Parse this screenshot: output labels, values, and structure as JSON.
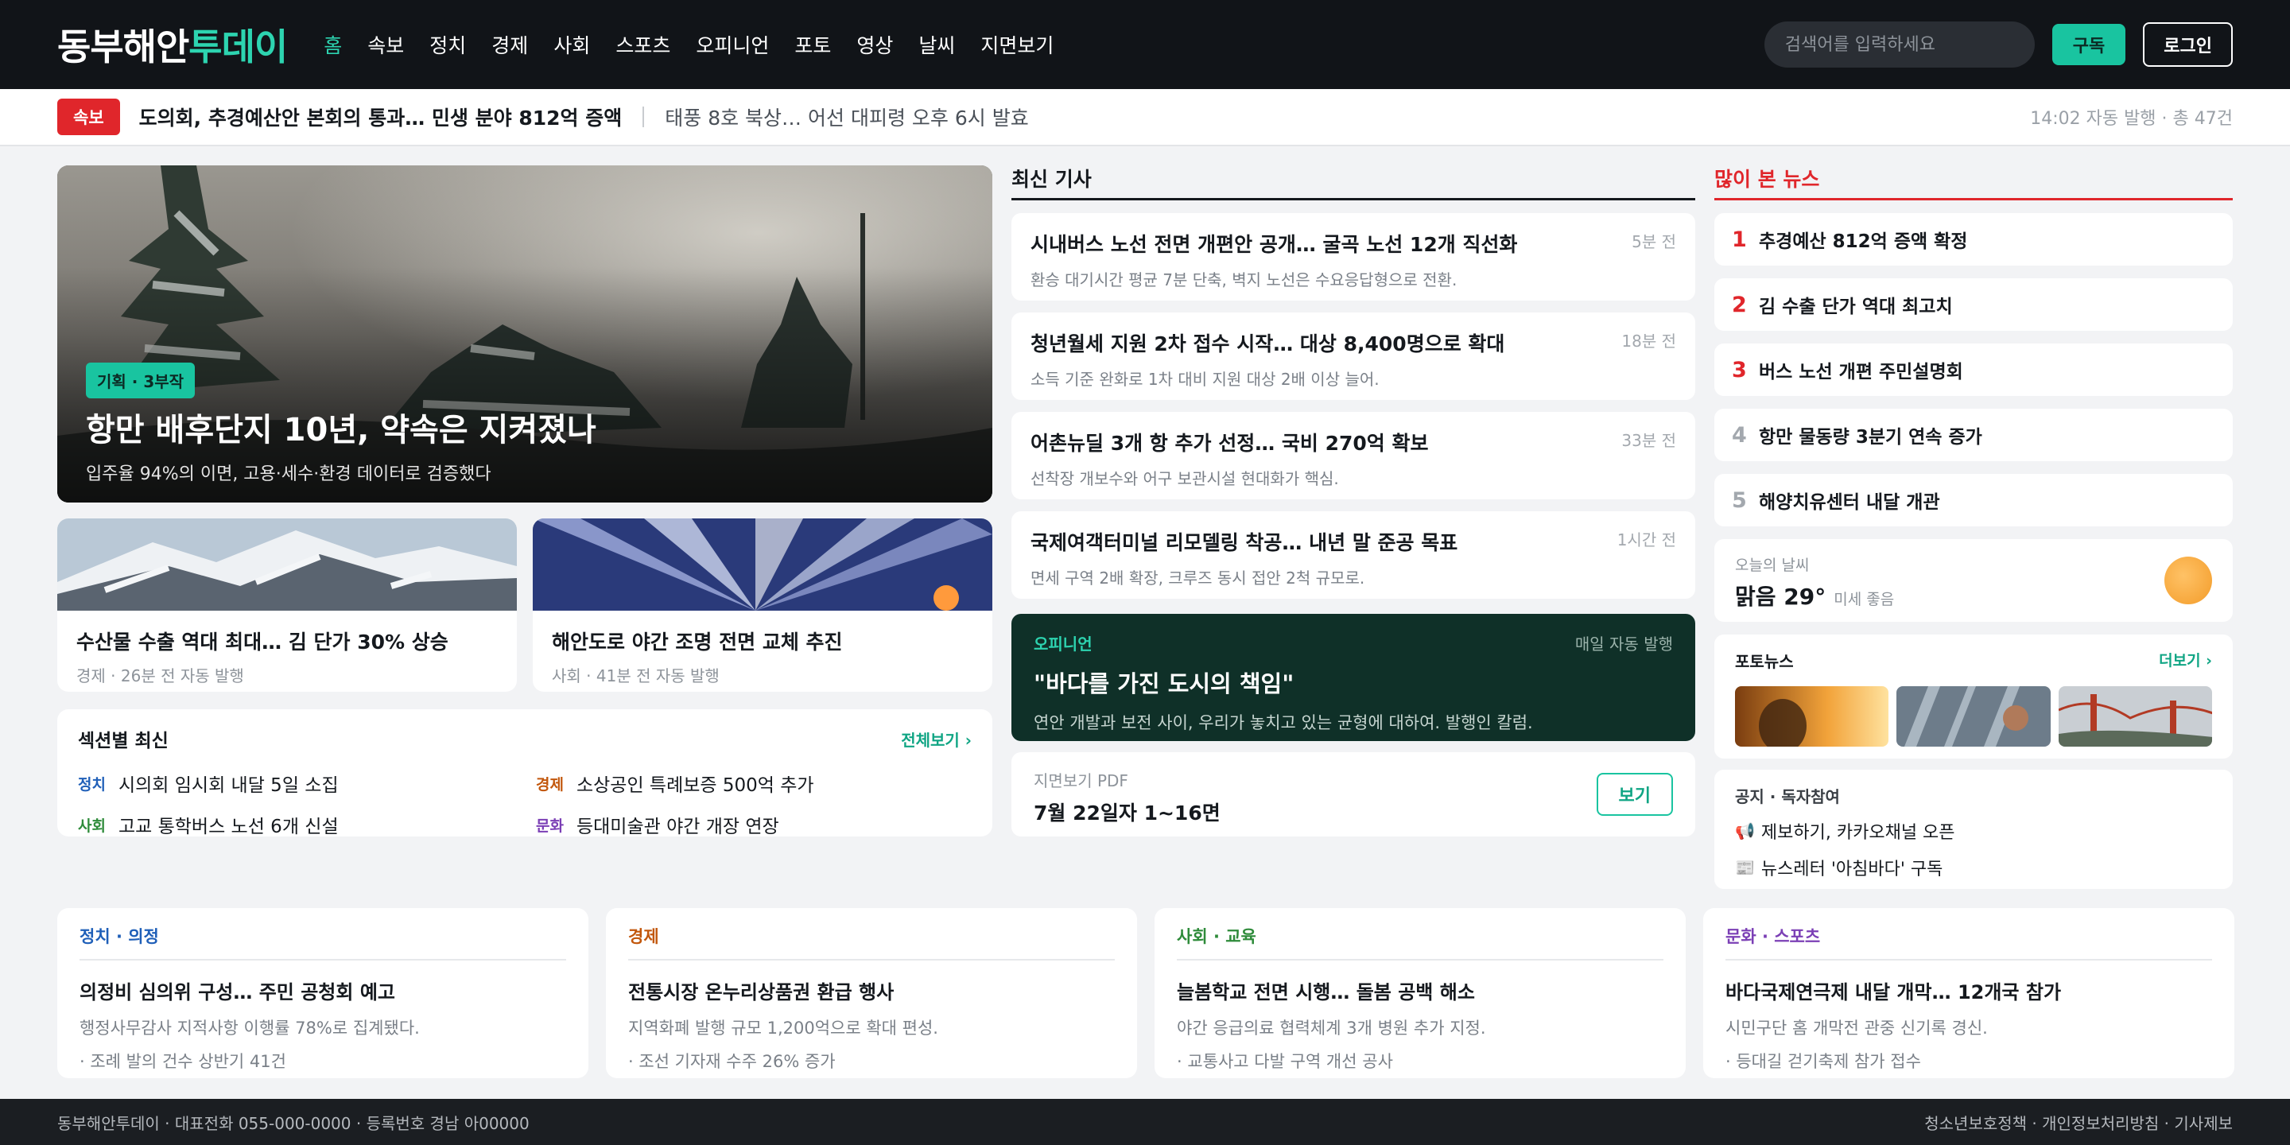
{
  "header": {
    "logo_main": "동부해안",
    "logo_accent": "투데이",
    "nav": [
      {
        "label": "홈",
        "active": true
      },
      {
        "label": "속보"
      },
      {
        "label": "정치"
      },
      {
        "label": "경제"
      },
      {
        "label": "사회"
      },
      {
        "label": "스포츠"
      },
      {
        "label": "오피니언"
      },
      {
        "label": "포토"
      },
      {
        "label": "영상"
      },
      {
        "label": "날씨"
      },
      {
        "label": "지면보기"
      }
    ],
    "search_placeholder": "검색어를 입력하세요",
    "subscribe_label": "구독",
    "login_label": "로그인"
  },
  "breaking": {
    "badge": "속보",
    "main": "도의회, 추경예산안 본회의 통과… 민생 분야 812억 증액",
    "secondary": "태풍 8호 북상… 어선 대피령 오후 6시 발효",
    "meta": "14:02 자동 발행 · 총 47건"
  },
  "hero": {
    "tag": "기획 · 3부작",
    "title": "항만 배후단지 10년, 약속은 지켜졌나",
    "subtitle": "입주율 94%의 이면, 고용·세수·환경 데이터로 검증했다"
  },
  "small_cards": [
    {
      "title": "수산물 수출 역대 최대… 김 단가 30% 상승",
      "meta": "경제 · 26분 전 자동 발행"
    },
    {
      "title": "해안도로 야간 조명 전면 교체 추진",
      "meta": "사회 · 41분 전 자동 발행"
    }
  ],
  "section_latest": {
    "title": "섹션별 최신",
    "more": "전체보기 ›",
    "items": [
      {
        "cat": "정치",
        "text": "시의회 임시회 내달 5일 소집",
        "color": "#1f5fb8"
      },
      {
        "cat": "경제",
        "text": "소상공인 특례보증 500억 추가",
        "color": "#c2570c"
      },
      {
        "cat": "사회",
        "text": "고교 통학버스 노선 6개 신설",
        "color": "#2e8b3a"
      },
      {
        "cat": "문화",
        "text": "등대미술관 야간 개장 연장",
        "color": "#7b3fb5"
      }
    ]
  },
  "latest": {
    "heading": "최신 기사",
    "articles": [
      {
        "title": "시내버스 노선 전면 개편안 공개… 굴곡 노선 12개 직선화",
        "summary": "환승 대기시간 평균 7분 단축, 벽지 노선은 수요응답형으로 전환.",
        "time": "5분 전"
      },
      {
        "title": "청년월세 지원 2차 접수 시작… 대상 8,400명으로 확대",
        "summary": "소득 기준 완화로 1차 대비 지원 대상 2배 이상 늘어.",
        "time": "18분 전"
      },
      {
        "title": "어촌뉴딜 3개 항 추가 선정… 국비 270억 확보",
        "summary": "선착장 개보수와 어구 보관시설 현대화가 핵심.",
        "time": "33분 전"
      },
      {
        "title": "국제여객터미널 리모델링 착공… 내년 말 준공 목표",
        "summary": "면세 구역 2배 확장, 크루즈 동시 접안 2척 규모로.",
        "time": "1시간 전"
      }
    ]
  },
  "opinion": {
    "label": "오피니언",
    "meta": "매일 자동 발행",
    "title": "\"바다를 가진 도시의 책임\"",
    "subtitle": "연안 개발과 보전 사이, 우리가 놓치고 있는 균형에 대하여. 발행인 칼럼."
  },
  "pdf": {
    "label": "지면보기 PDF",
    "title": "7월 22일자 1~16면",
    "button": "보기"
  },
  "most_viewed": {
    "heading": "많이 본 뉴스",
    "items": [
      {
        "rank": "1",
        "text": "추경예산 812억 증액 확정",
        "color": "#e0262b"
      },
      {
        "rank": "2",
        "text": "김 수출 단가 역대 최고치",
        "color": "#e0262b"
      },
      {
        "rank": "3",
        "text": "버스 노선 개편 주민설명회",
        "color": "#e0262b"
      },
      {
        "rank": "4",
        "text": "항만 물동량 3분기 연속 증가",
        "color": "#a3a8ae"
      },
      {
        "rank": "5",
        "text": "해양치유센터 내달 개관",
        "color": "#a3a8ae"
      }
    ]
  },
  "weather": {
    "label": "오늘의 날씨",
    "temp": "맑음 29°",
    "sub": "미세 좋음"
  },
  "photo_news": {
    "title": "포토뉴스",
    "more": "더보기 ›"
  },
  "notice": {
    "title": "공지 · 독자참여",
    "items": [
      {
        "icon": "📢",
        "text": "제보하기, 카카오채널 오픈"
      },
      {
        "icon": "📰",
        "text": "뉴스레터 '아침바다' 구독"
      }
    ]
  },
  "bottom_cards": [
    {
      "cat": "정치 · 의정",
      "color": "#1f5fb8",
      "title": "의정비 심의위 구성… 주민 공청회 예고",
      "summary": "행정사무감사 지적사항 이행률 78%로 집계됐다.",
      "extra": "· 조례 발의 건수 상반기 41건"
    },
    {
      "cat": "경제",
      "color": "#c2570c",
      "title": "전통시장 온누리상품권 환급 행사",
      "summary": "지역화폐 발행 규모 1,200억으로 확대 편성.",
      "extra": "· 조선 기자재 수주 26% 증가"
    },
    {
      "cat": "사회 · 교육",
      "color": "#2e8b3a",
      "title": "늘봄학교 전면 시행… 돌봄 공백 해소",
      "summary": "야간 응급의료 협력체계 3개 병원 추가 지정.",
      "extra": "· 교통사고 다발 구역 개선 공사"
    },
    {
      "cat": "문화 · 스포츠",
      "color": "#7b3fb5",
      "title": "바다국제연극제 내달 개막… 12개국 참가",
      "summary": "시민구단 홈 개막전 관중 신기록 경신.",
      "extra": "· 등대길 걷기축제 참가 접수"
    }
  ],
  "footer": {
    "left": "동부해안투데이 · 대표전화 055-000-0000 · 등록번호 경남 아00000",
    "right": "청소년보호정책 · 개인정보처리방침 · 기사제보"
  }
}
